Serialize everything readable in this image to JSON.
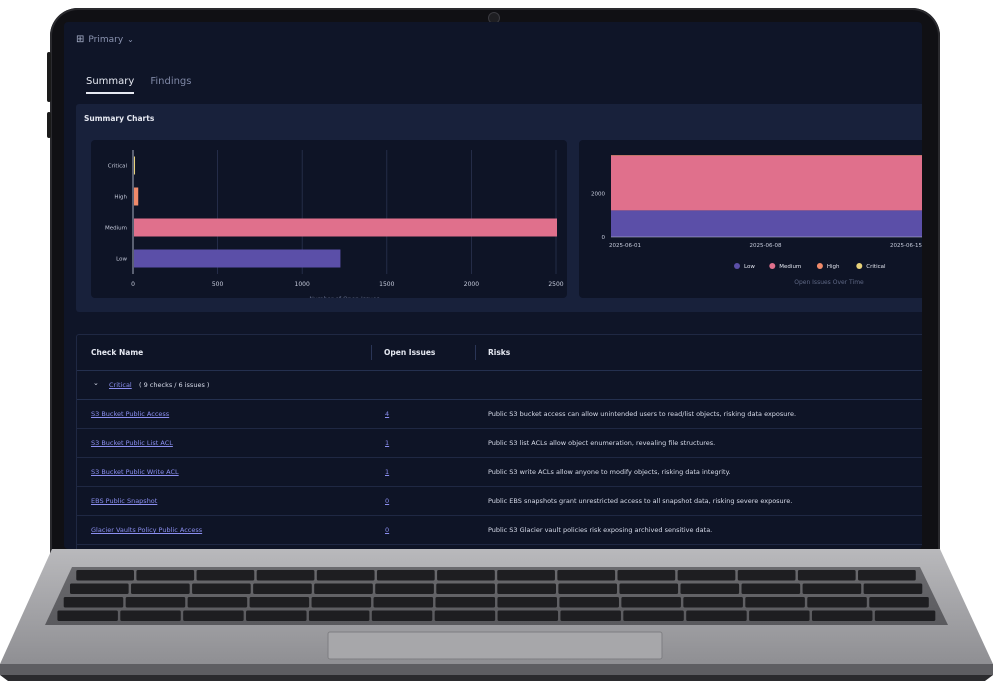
{
  "account": {
    "icon": "grid-icon",
    "label": "Primary",
    "caret": "⌄"
  },
  "tabs": [
    {
      "label": "Summary",
      "active": true
    },
    {
      "label": "Findings",
      "active": false
    }
  ],
  "panel": {
    "title": "Summary Charts"
  },
  "colors": {
    "low": "#5b4fa8",
    "medium": "#e0708c",
    "high": "#f08a6a",
    "critical": "#e8d27a"
  },
  "chart_data": [
    {
      "type": "bar",
      "orientation": "horizontal",
      "categories": [
        "Critical",
        "High",
        "Medium",
        "Low"
      ],
      "values": [
        6,
        25,
        2500,
        1220
      ],
      "xlabel": "Number of Open Issues",
      "xlim": [
        0,
        2500
      ],
      "xticks": [
        "0",
        "500",
        "1000",
        "1500",
        "2000",
        "2500"
      ],
      "grid": true
    },
    {
      "type": "area",
      "stacked": true,
      "x": [
        "2025-06-01",
        "2025-06-08",
        "2025-06-15"
      ],
      "series": [
        {
          "name": "Low",
          "values": [
            1220,
            1220,
            1220
          ]
        },
        {
          "name": "Medium",
          "values": [
            2500,
            2500,
            2500
          ]
        },
        {
          "name": "High",
          "values": [
            25,
            25,
            25
          ]
        },
        {
          "name": "Critical",
          "values": [
            6,
            6,
            6
          ]
        }
      ],
      "xlabel": "Open Issues Over Time",
      "yticks": [
        "0",
        "2000"
      ],
      "legend": "bottom-right"
    }
  ],
  "table": {
    "headers": {
      "check": "Check Name",
      "open": "Open Issues",
      "risks": "Risks"
    },
    "group": {
      "chevron": "⌄",
      "name": "Critical",
      "summary": "( 9 checks / 6 issues )"
    },
    "rows": [
      {
        "name": "S3 Bucket Public Access",
        "count": "4",
        "risk": "Public S3 bucket access can allow unintended users to read/list objects, risking data exposure."
      },
      {
        "name": "S3 Bucket Public List ACL",
        "count": "1",
        "risk": "Public S3 list ACLs allow object enumeration, revealing file structures."
      },
      {
        "name": "S3 Bucket Public Write ACL",
        "count": "1",
        "risk": "Public S3 write ACLs allow anyone to modify objects, risking data integrity."
      },
      {
        "name": "EBS Public Snapshot",
        "count": "0",
        "risk": "Public EBS snapshots grant unrestricted access to all snapshot data, risking severe exposure."
      },
      {
        "name": "Glacier Vaults Policy Public Access",
        "count": "0",
        "risk": "Public S3 Glacier vault policies risk exposing archived sensitive data."
      }
    ]
  }
}
